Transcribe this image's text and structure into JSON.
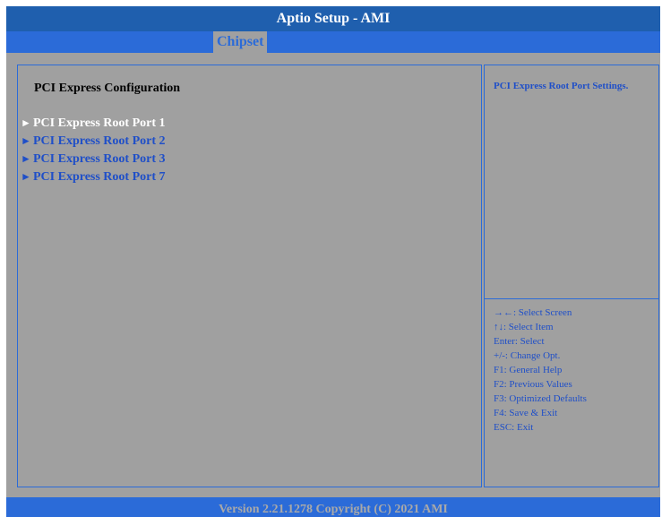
{
  "app": {
    "title": "Aptio Setup - AMI"
  },
  "tabs": [
    {
      "label": "Chipset",
      "active": true
    }
  ],
  "main": {
    "title": "PCI Express Configuration",
    "items": [
      {
        "label": "PCI Express Root Port 1",
        "selected": true
      },
      {
        "label": "PCI Express Root Port 2",
        "selected": false
      },
      {
        "label": "PCI Express Root Port 3",
        "selected": false
      },
      {
        "label": "PCI Express Root Port 7",
        "selected": false
      }
    ],
    "submenu_marker": "►"
  },
  "help": {
    "text": "PCI Express Root Port Settings."
  },
  "keys": [
    "→←: Select Screen",
    "↑↓: Select Item",
    "Enter: Select",
    "+/-: Change Opt.",
    "F1: General Help",
    "F2: Previous Values",
    "F3: Optimized Defaults",
    "F4: Save & Exit",
    "ESC: Exit"
  ],
  "footer": {
    "text": "Version 2.21.1278 Copyright (C) 2021 AMI"
  },
  "colors": {
    "title_bg": "#1f5fae",
    "tab_bar_bg": "#2b6bd8",
    "panel_bg": "#a0a0a0",
    "item_selected": "#ffffff",
    "item_normal": "#1f4fc8",
    "help_text": "#1f4fc8"
  }
}
